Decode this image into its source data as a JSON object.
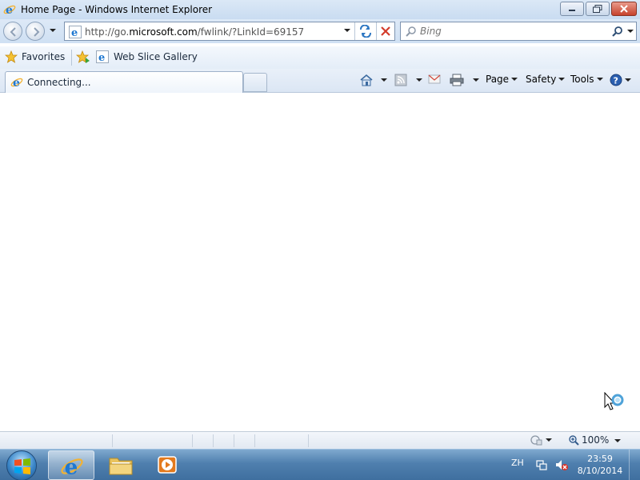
{
  "window": {
    "title": "Home Page - Windows Internet Explorer"
  },
  "address_bar": {
    "url_prefix": "http://go.",
    "url_domain": "microsoft.com",
    "url_suffix": "/fwlink/?LinkId=69157"
  },
  "search": {
    "placeholder": "Bing"
  },
  "favorites_bar": {
    "favorites_label": "Favorites",
    "items": [
      {
        "label": "Web Slice Gallery"
      }
    ]
  },
  "tabs": [
    {
      "label": "Connecting..."
    }
  ],
  "command_bar": {
    "page_label": "Page",
    "safety_label": "Safety",
    "tools_label": "Tools"
  },
  "status_bar": {
    "zoom": "100%"
  },
  "taskbar": {
    "language": "ZH",
    "time": "23:59",
    "date": "8/10/2014"
  },
  "colors": {
    "accent": "#3a86c8",
    "close_button": "#c6422c",
    "ie_blue": "#1f78d1",
    "ie_orange": "#f2b233"
  }
}
